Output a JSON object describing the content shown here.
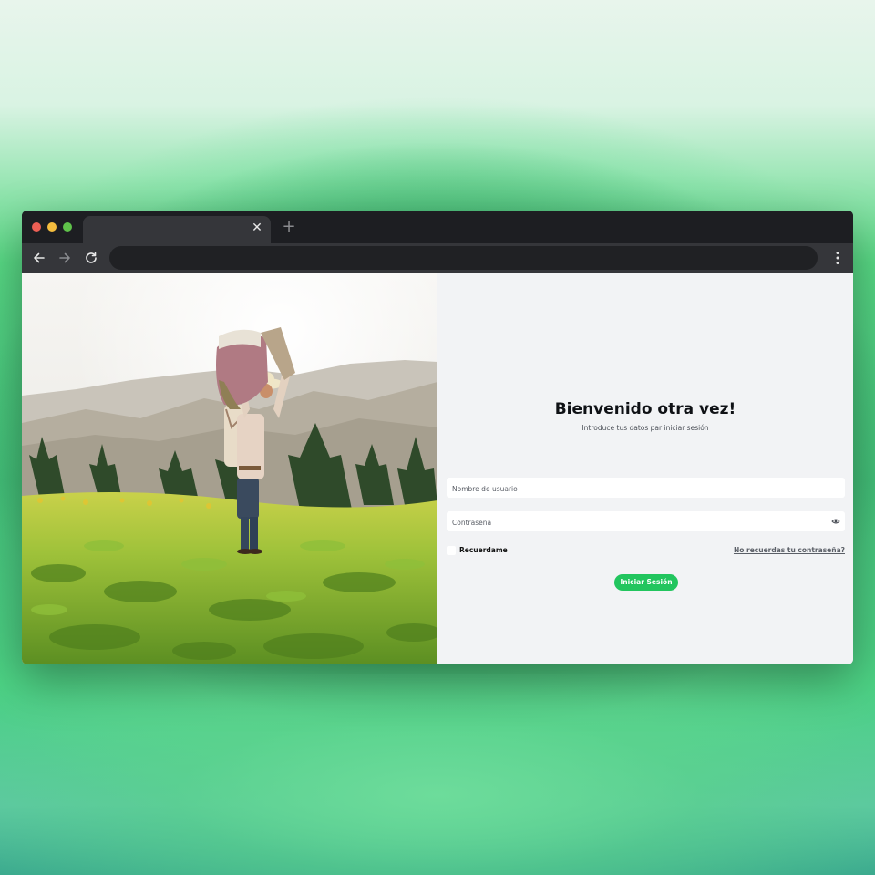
{
  "browser": {
    "tab_close_glyph": "✕",
    "new_tab_glyph": "+",
    "icons": [
      "back-arrow-icon",
      "forward-arrow-icon",
      "reload-icon",
      "kebab-menu-icon",
      "close-icon",
      "plus-icon"
    ]
  },
  "login": {
    "title": "Bienvenido otra vez!",
    "subtitle": "Introduce tus datos par iniciar sesión",
    "username_placeholder": "Nombre de usuario",
    "password_placeholder": "Contraseña",
    "remember_label": "Recuerdame",
    "forgot_link": "No recuerdas tu contraseña?",
    "submit_label": "Iniciar Sesión",
    "accent_color": "#22c55e"
  },
  "hero_image": {
    "subject": "farmer-carrying-sack-in-field"
  }
}
